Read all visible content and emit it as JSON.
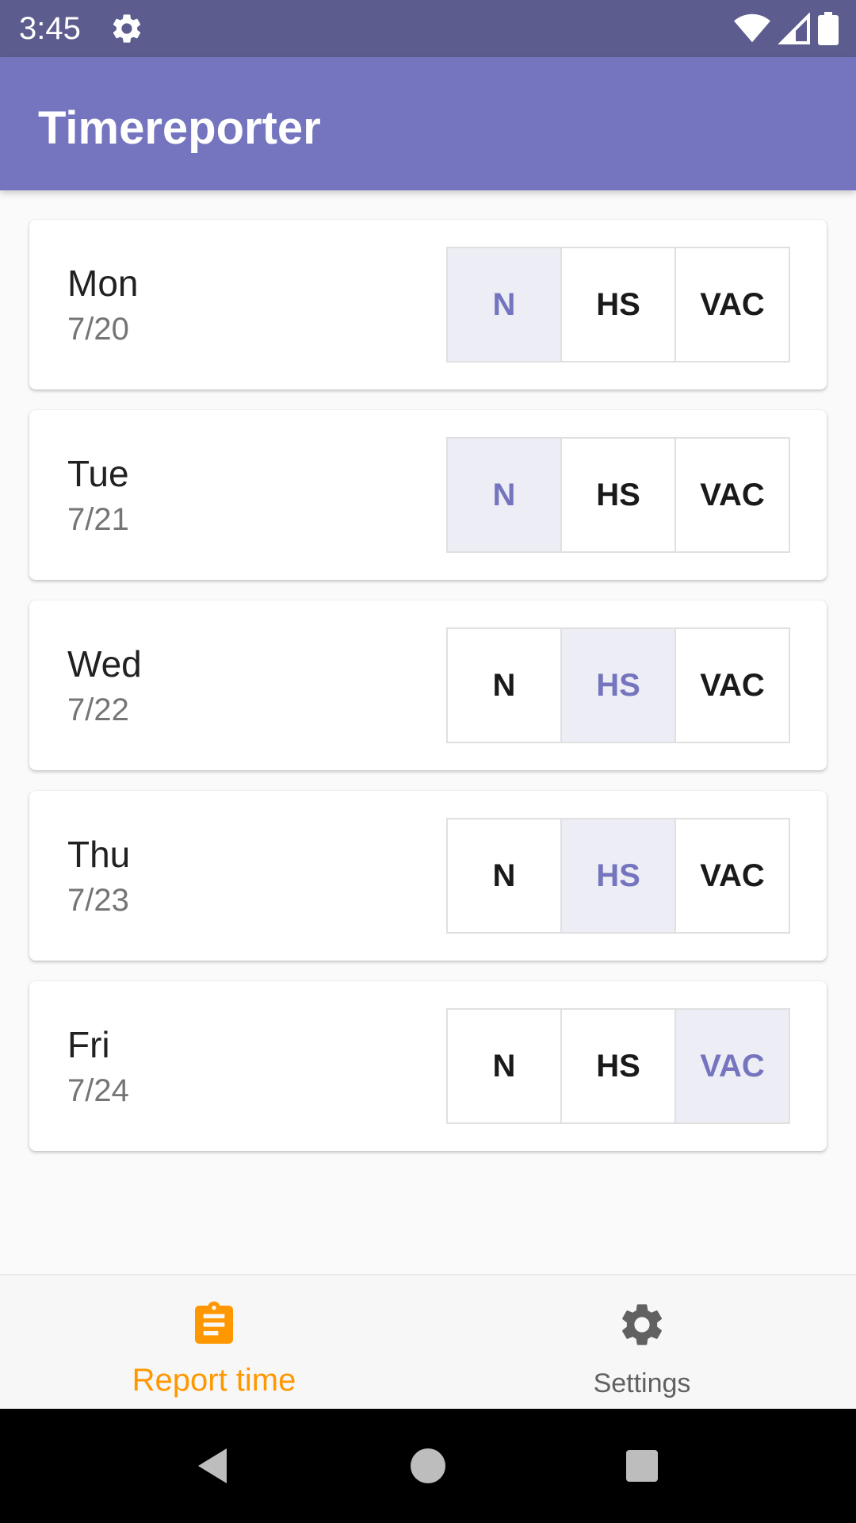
{
  "status_bar": {
    "time": "3:45",
    "icons": [
      "settings-icon",
      "wifi-icon",
      "signal-icon",
      "battery-icon"
    ]
  },
  "app_bar": {
    "title": "Timereporter"
  },
  "days": [
    {
      "name": "Mon",
      "date": "7/20",
      "options": [
        "N",
        "HS",
        "VAC"
      ],
      "selected": 0
    },
    {
      "name": "Tue",
      "date": "7/21",
      "options": [
        "N",
        "HS",
        "VAC"
      ],
      "selected": 0
    },
    {
      "name": "Wed",
      "date": "7/22",
      "options": [
        "N",
        "HS",
        "VAC"
      ],
      "selected": 1
    },
    {
      "name": "Thu",
      "date": "7/23",
      "options": [
        "N",
        "HS",
        "VAC"
      ],
      "selected": 1
    },
    {
      "name": "Fri",
      "date": "7/24",
      "options": [
        "N",
        "HS",
        "VAC"
      ],
      "selected": 2
    }
  ],
  "bottom_nav": {
    "items": [
      {
        "label": "Report time",
        "icon": "clipboard-icon",
        "active": true
      },
      {
        "label": "Settings",
        "icon": "gear-icon",
        "active": false
      }
    ]
  },
  "system_nav": {
    "icons": [
      "back-icon",
      "home-icon",
      "recents-icon"
    ]
  },
  "colors": {
    "status_bar": "#5C5C8F",
    "app_bar": "#7475BE",
    "selected_bg": "#EDEDF6",
    "selected_text": "#7475BE",
    "active_nav": "#FF9800",
    "inactive_nav": "#616161"
  }
}
